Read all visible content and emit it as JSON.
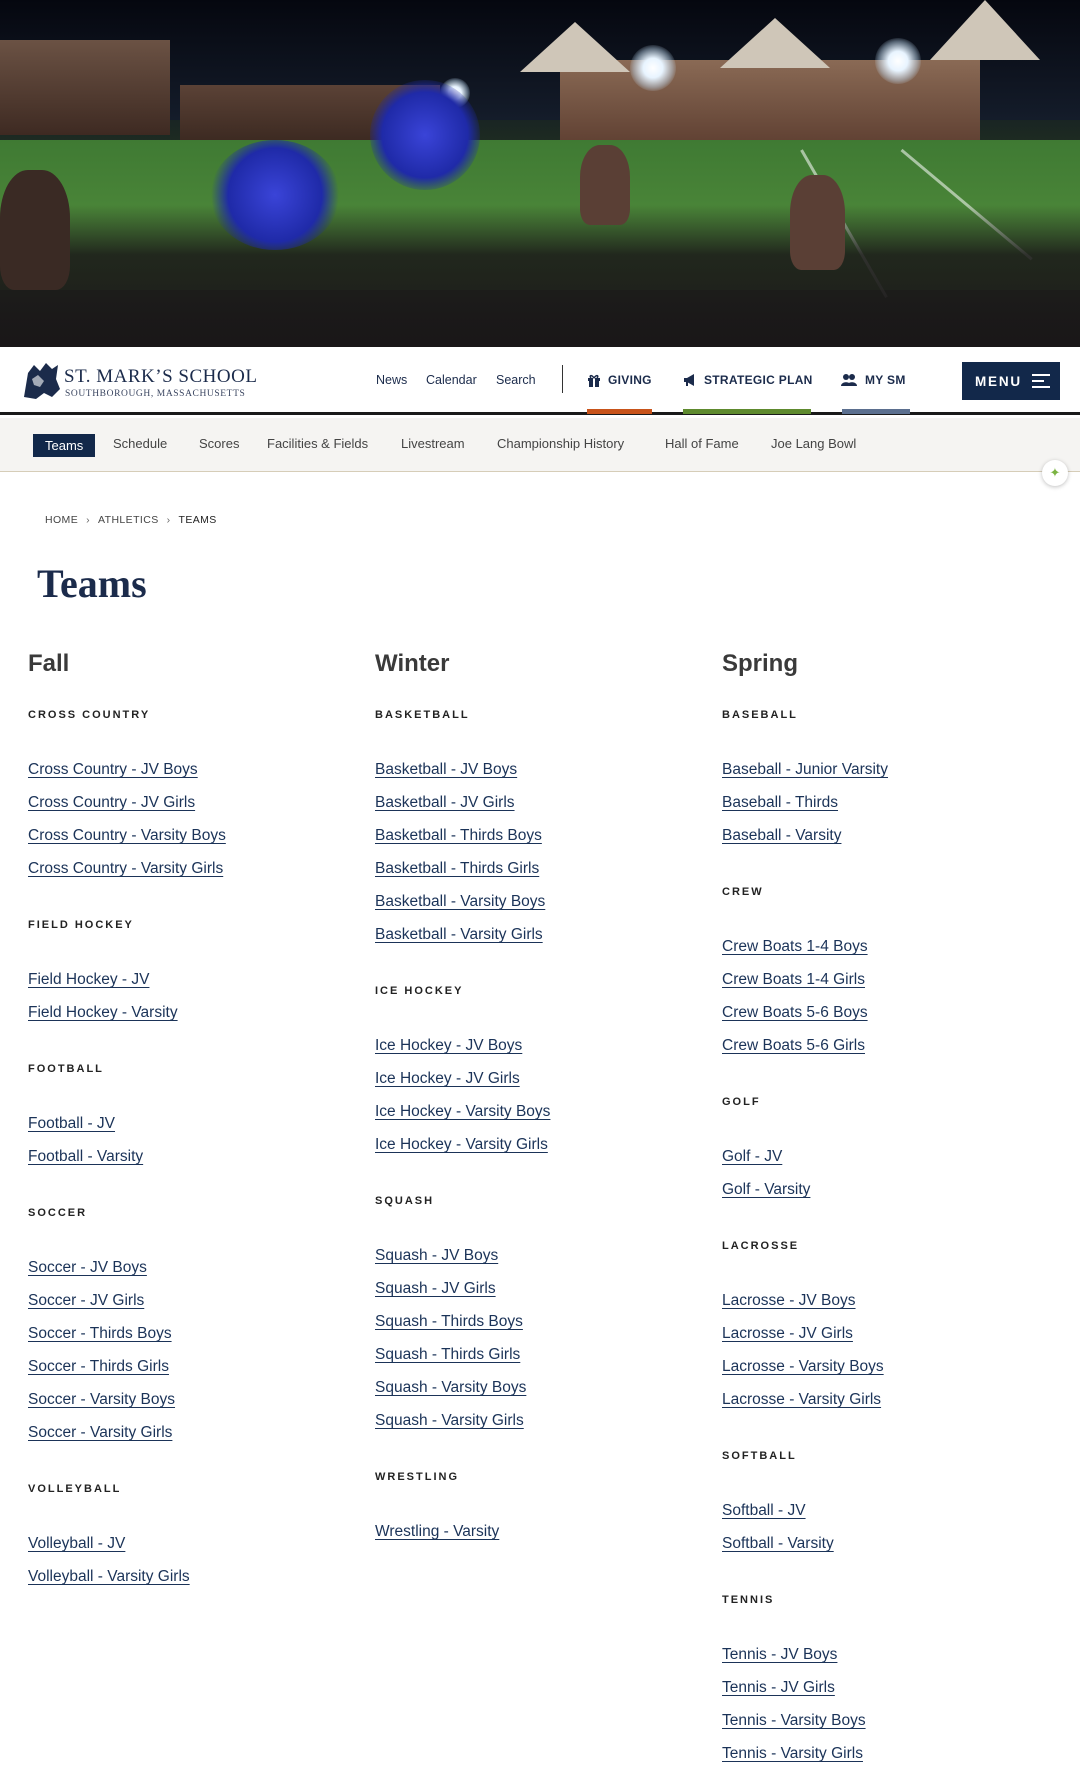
{
  "hero": {
    "alt_description": ""
  },
  "header": {
    "logo": {
      "name": "ST. MARK’S SCHOOL",
      "location": "SOUTHBOROUGH, MASSACHUSETTS"
    },
    "utility_links": [
      "News",
      "Calendar",
      "Search"
    ],
    "ctas": [
      {
        "label": "GIVING",
        "icon": "gift-icon",
        "accent": "#c8531a"
      },
      {
        "label": "STRATEGIC PLAN",
        "icon": "megaphone-icon",
        "accent": "#5e8a2e"
      },
      {
        "label": "MY SM",
        "icon": "users-icon",
        "accent": "#5b6f8f"
      }
    ],
    "menu_label": "MENU"
  },
  "subnav": {
    "items": [
      "Teams",
      "Schedule",
      "Scores",
      "Facilities & Fields",
      "Livestream",
      "Championship History",
      "Hall of Fame",
      "Joe Lang Bowl"
    ],
    "active": "Teams"
  },
  "breadcrumb": [
    "HOME",
    "ATHLETICS",
    "TEAMS"
  ],
  "page_title": "Teams",
  "seasons": [
    {
      "name": "Fall",
      "groups": [
        {
          "label": "CROSS COUNTRY",
          "teams": [
            "Cross Country - JV Boys",
            "Cross Country - JV Girls",
            "Cross Country - Varsity Boys",
            "Cross Country - Varsity Girls"
          ]
        },
        {
          "label": "FIELD HOCKEY",
          "teams": [
            "Field Hockey - JV",
            "Field Hockey - Varsity"
          ]
        },
        {
          "label": "FOOTBALL",
          "teams": [
            "Football - JV",
            "Football - Varsity"
          ]
        },
        {
          "label": "SOCCER",
          "teams": [
            "Soccer - JV Boys",
            "Soccer - JV Girls",
            "Soccer - Thirds Boys",
            "Soccer - Thirds Girls",
            "Soccer - Varsity Boys",
            "Soccer - Varsity Girls"
          ]
        },
        {
          "label": "VOLLEYBALL",
          "teams": [
            "Volleyball - JV",
            "Volleyball - Varsity Girls"
          ]
        }
      ]
    },
    {
      "name": "Winter",
      "groups": [
        {
          "label": "BASKETBALL",
          "teams": [
            "Basketball - JV Boys",
            "Basketball - JV Girls",
            "Basketball - Thirds Boys",
            "Basketball - Thirds Girls",
            "Basketball - Varsity Boys",
            "Basketball - Varsity Girls"
          ]
        },
        {
          "label": "ICE HOCKEY",
          "teams": [
            "Ice Hockey - JV Boys",
            "Ice Hockey - JV Girls",
            "Ice Hockey - Varsity Boys",
            "Ice Hockey - Varsity Girls"
          ]
        },
        {
          "label": "SQUASH",
          "teams": [
            "Squash - JV Boys",
            "Squash - JV Girls",
            "Squash - Thirds Boys",
            "Squash - Thirds Girls",
            "Squash - Varsity Boys",
            "Squash - Varsity Girls"
          ]
        },
        {
          "label": "WRESTLING",
          "teams": [
            "Wrestling - Varsity"
          ]
        }
      ]
    },
    {
      "name": "Spring",
      "groups": [
        {
          "label": "BASEBALL",
          "teams": [
            "Baseball - Junior Varsity",
            "Baseball - Thirds",
            "Baseball - Varsity"
          ]
        },
        {
          "label": "CREW",
          "teams": [
            "Crew Boats 1-4 Boys",
            "Crew Boats 1-4 Girls",
            "Crew Boats 5-6 Boys",
            "Crew Boats 5-6 Girls"
          ]
        },
        {
          "label": "GOLF",
          "teams": [
            "Golf - JV",
            "Golf - Varsity"
          ]
        },
        {
          "label": "LACROSSE",
          "teams": [
            "Lacrosse - JV Boys",
            "Lacrosse - JV Girls",
            "Lacrosse - Varsity Boys",
            "Lacrosse - Varsity Girls"
          ]
        },
        {
          "label": "SOFTBALL",
          "teams": [
            "Softball - JV",
            "Softball - Varsity"
          ]
        },
        {
          "label": "TENNIS",
          "teams": [
            "Tennis - JV Boys",
            "Tennis - JV Girls",
            "Tennis - Varsity Boys",
            "Tennis - Varsity Girls"
          ]
        }
      ]
    }
  ],
  "colors": {
    "navy": "#12284a",
    "link": "#1b3358"
  }
}
